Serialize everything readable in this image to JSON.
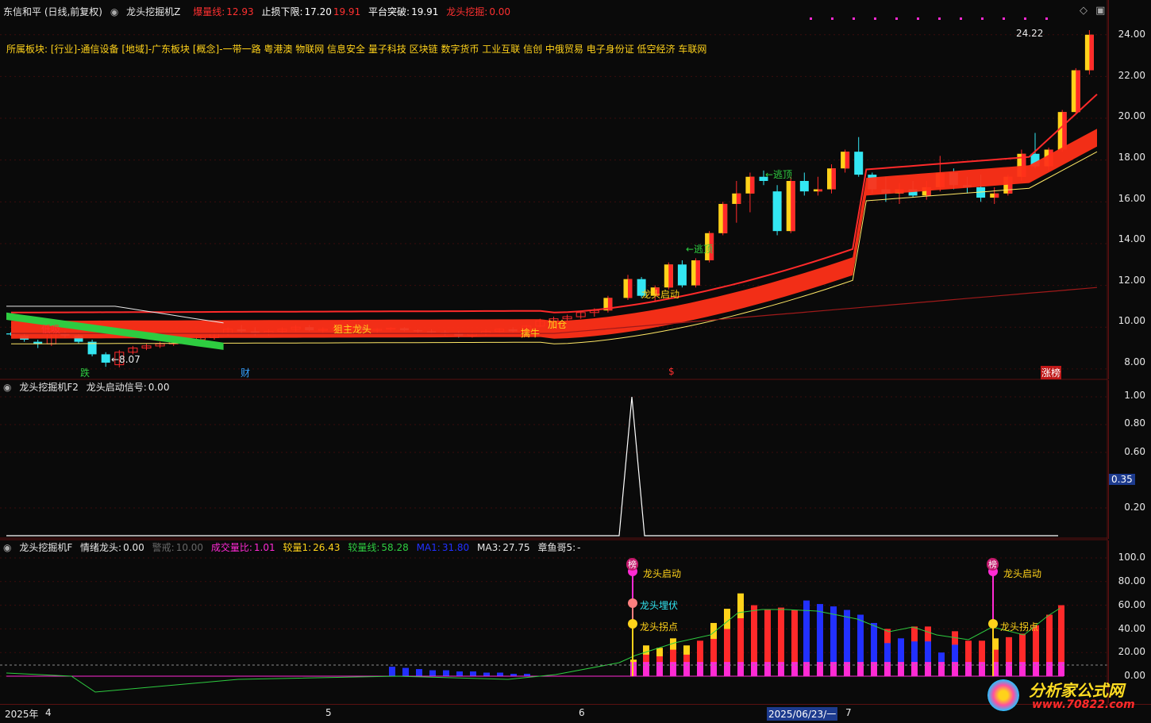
{
  "header": {
    "title": "东信和平 (日线,前复权)",
    "indicator": "龙头挖掘机Z",
    "burst_label": "爆量线:",
    "burst_value": "12.93",
    "stop_label": "止损下限:",
    "stop_value": "17.20",
    "stop_value2": "19.91",
    "platform_label": "平台突破:",
    "platform_value": "19.91",
    "dig_label": "龙头挖掘:",
    "dig_value": "0.00",
    "sector_line": "所属板块: [行业]-通信设备 [地域]-广东板块 [概念]-一带一路 粤港澳 物联网 信息安全 量子科技 区块链 数字货币 工业互联 信创 中俄贸易 电子身份证 低空经济 车联网"
  },
  "main_annotations": {
    "low_buy": "低吸",
    "low_price": "←8.07",
    "catch_dragon": "狙主龙头",
    "grab_bull": "擒牛",
    "add_pos": "加仓",
    "dragon_start": "龙头启动",
    "escape_top": "←逃顶",
    "escape_top2": "←逃顶",
    "high_price": "24.22",
    "mark_fall": "跌",
    "mark_fin": "财",
    "mark_s": "$",
    "mark_limit": "涨榜"
  },
  "price_axis": [
    "24.00",
    "22.00",
    "20.00",
    "18.00",
    "16.00",
    "14.00",
    "12.00",
    "10.00",
    "8.00"
  ],
  "pane2": {
    "name": "龙头挖掘机F2",
    "signal_label": "龙头启动信号:",
    "signal_value": "0.00",
    "axis": [
      "1.00",
      "0.80",
      "0.60",
      "0.35",
      "0.20"
    ]
  },
  "pane3": {
    "name": "龙头挖掘机F",
    "emo_label": "情绪龙头:",
    "emo_value": "0.00",
    "warn_label": "警戒:",
    "warn_value": "10.00",
    "volratio_label": "成交量比:",
    "volratio_value": "1.01",
    "vol1_label": "较量1:",
    "vol1_value": "26.43",
    "volline_label": "较量线:",
    "volline_value": "58.28",
    "ma1_label": "MA1:",
    "ma1_value": "31.80",
    "ma3_label": "MA3:",
    "ma3_value": "27.75",
    "octo_label": "章鱼哥5:",
    "octo_value": "-",
    "axis": [
      "100.0",
      "80.00",
      "60.00",
      "40.00",
      "20.00",
      "0.00"
    ],
    "ann_start1": "龙头启动",
    "ann_ambush": "龙头埋伏",
    "ann_pick1": "龙头拐点",
    "ann_start2": "龙头启动",
    "ann_pick2": "龙头拐点",
    "badge_bang": "榜"
  },
  "date_axis": {
    "year": "2025年",
    "m4": "4",
    "m5": "5",
    "m6": "6",
    "cursor_date": "2025/06/23/一",
    "m7": "7"
  },
  "watermark": {
    "cn": "分析家公式网",
    "url": "www.70822.com"
  },
  "colors": {
    "bg": "#0a0a0a",
    "up": "#ff2a2a",
    "down": "#33e6f2",
    "yellow": "#ffd21a",
    "green": "#2ecc40",
    "magenta": "#ff2ad4",
    "blue": "#2230ff",
    "grid": "#5a1010"
  },
  "chart_data": {
    "type": "candlestick",
    "ylim": [
      7.5,
      24.6
    ],
    "candles": [
      [
        9.7,
        9.75,
        9.6,
        9.65
      ],
      [
        9.6,
        9.7,
        9.3,
        9.4
      ],
      [
        9.3,
        9.4,
        9.0,
        9.2
      ],
      [
        9.2,
        9.8,
        9.1,
        9.7
      ],
      [
        9.7,
        9.8,
        9.5,
        9.6
      ],
      [
        9.6,
        9.7,
        9.2,
        9.3
      ],
      [
        9.3,
        9.4,
        8.6,
        8.7
      ],
      [
        8.7,
        8.8,
        8.1,
        8.3
      ],
      [
        8.2,
        8.9,
        8.07,
        8.8
      ],
      [
        8.8,
        9.1,
        8.7,
        9.0
      ],
      [
        9.0,
        9.2,
        8.9,
        9.1
      ],
      [
        9.1,
        9.3,
        9.0,
        9.2
      ],
      [
        9.2,
        9.4,
        9.1,
        9.3
      ],
      [
        9.3,
        9.5,
        9.2,
        9.4
      ],
      [
        9.4,
        9.6,
        9.3,
        9.5
      ],
      [
        9.5,
        9.8,
        9.4,
        9.7
      ],
      [
        9.7,
        10.0,
        9.6,
        9.9
      ],
      [
        9.9,
        10.1,
        9.7,
        9.8
      ],
      [
        9.8,
        10.0,
        9.6,
        9.7
      ],
      [
        9.7,
        9.9,
        9.6,
        9.8
      ],
      [
        9.8,
        10.0,
        9.7,
        9.9
      ],
      [
        9.9,
        10.1,
        9.8,
        10.0
      ],
      [
        10.0,
        10.1,
        9.8,
        9.85
      ],
      [
        9.85,
        10.0,
        9.7,
        9.9
      ],
      [
        9.9,
        10.0,
        9.8,
        9.95
      ],
      [
        9.95,
        10.1,
        9.9,
        10.0
      ],
      [
        10.0,
        10.1,
        9.8,
        9.85
      ],
      [
        9.85,
        9.95,
        9.7,
        9.9
      ],
      [
        9.9,
        10.0,
        9.8,
        9.95
      ],
      [
        9.95,
        10.0,
        9.8,
        9.85
      ],
      [
        9.85,
        9.9,
        9.7,
        9.8
      ],
      [
        9.8,
        9.9,
        9.7,
        9.75
      ],
      [
        9.75,
        9.85,
        9.6,
        9.7
      ],
      [
        9.7,
        9.8,
        9.5,
        9.6
      ],
      [
        9.6,
        9.8,
        9.5,
        9.7
      ],
      [
        9.7,
        9.9,
        9.6,
        9.8
      ],
      [
        9.8,
        9.95,
        9.7,
        9.9
      ],
      [
        9.9,
        10.0,
        9.75,
        9.8
      ],
      [
        9.8,
        10.1,
        9.75,
        10.05
      ],
      [
        10.05,
        10.4,
        10.0,
        10.3
      ],
      [
        10.3,
        10.5,
        10.2,
        10.4
      ],
      [
        10.4,
        10.6,
        10.3,
        10.5
      ],
      [
        10.5,
        10.8,
        10.4,
        10.7
      ],
      [
        10.7,
        10.9,
        10.5,
        10.8
      ],
      [
        10.8,
        11.5,
        10.7,
        11.4
      ],
      [
        11.4,
        12.5,
        11.3,
        12.3
      ],
      [
        12.3,
        12.4,
        11.4,
        11.5
      ],
      [
        11.5,
        12.0,
        11.2,
        11.9
      ],
      [
        11.9,
        13.1,
        11.8,
        13.0
      ],
      [
        13.0,
        13.2,
        11.9,
        12.0
      ],
      [
        12.0,
        13.3,
        11.9,
        13.2
      ],
      [
        13.2,
        14.6,
        13.1,
        14.5
      ],
      [
        14.5,
        16.0,
        14.4,
        15.9
      ],
      [
        15.9,
        17.0,
        15.0,
        16.4
      ],
      [
        16.4,
        17.4,
        15.5,
        17.2
      ],
      [
        17.2,
        17.5,
        16.8,
        17.0
      ],
      [
        16.5,
        16.8,
        14.4,
        14.6
      ],
      [
        14.6,
        17.2,
        14.5,
        17.0
      ],
      [
        17.0,
        17.4,
        16.3,
        16.5
      ],
      [
        16.5,
        17.2,
        16.3,
        16.6
      ],
      [
        16.6,
        17.8,
        16.4,
        17.6
      ],
      [
        17.6,
        18.5,
        17.4,
        18.4
      ],
      [
        18.4,
        19.1,
        17.2,
        17.3
      ],
      [
        17.3,
        17.4,
        16.4,
        16.6
      ],
      [
        16.6,
        17.2,
        16.0,
        16.4
      ],
      [
        16.4,
        16.9,
        15.9,
        16.6
      ],
      [
        16.6,
        17.0,
        16.2,
        16.3
      ],
      [
        16.3,
        17.0,
        16.1,
        16.7
      ],
      [
        16.7,
        18.2,
        16.5,
        17.4
      ],
      [
        17.4,
        17.6,
        16.6,
        16.8
      ],
      [
        16.8,
        17.2,
        16.4,
        16.7
      ],
      [
        16.7,
        17.3,
        16.0,
        16.2
      ],
      [
        16.2,
        16.7,
        15.9,
        16.4
      ],
      [
        16.4,
        17.3,
        16.3,
        17.2
      ],
      [
        17.2,
        18.5,
        17.0,
        18.3
      ],
      [
        18.3,
        19.3,
        17.6,
        17.7
      ],
      [
        17.7,
        18.6,
        17.5,
        18.5
      ],
      [
        18.5,
        20.4,
        18.4,
        20.3
      ],
      [
        20.3,
        22.4,
        20.2,
        22.3
      ],
      [
        22.3,
        24.22,
        22.1,
        24.0
      ]
    ]
  }
}
